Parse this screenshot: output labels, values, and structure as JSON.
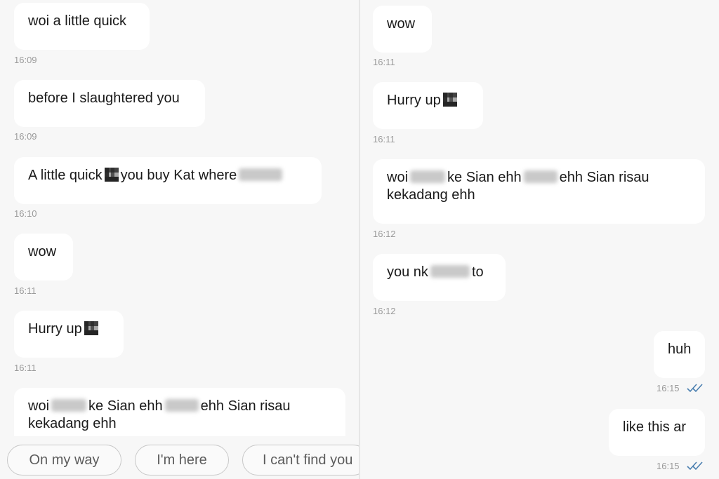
{
  "left": {
    "messages": [
      {
        "text": "woi a little quick",
        "time": "16:09"
      },
      {
        "text": "before I slaughtered you",
        "time": "16:09"
      },
      {
        "part1": "A little quick",
        "part2": "you buy Kat where",
        "time": "16:10"
      },
      {
        "text": "wow",
        "time": "16:11"
      },
      {
        "text": "Hurry up",
        "time": "16:11"
      },
      {
        "line1_a": "woi",
        "line1_b": "ke Sian ehh",
        "line1_c": "ehh Sian risau",
        "line2": "kekadang ehh"
      }
    ],
    "quick_replies": [
      "On my way",
      "I'm here",
      "I can't find you"
    ]
  },
  "right": {
    "messages": [
      {
        "text": "wow",
        "time": "16:11"
      },
      {
        "text": "Hurry up",
        "time": "16:11"
      },
      {
        "line1_a": "woi",
        "line1_b": "ke Sian ehh",
        "line1_c": "ehh Sian risau",
        "line2": "kekadang ehh",
        "time": "16:12"
      },
      {
        "part1": "you nk",
        "part2": "to",
        "time": "16:12"
      },
      {
        "text": "huh",
        "time": "16:15",
        "status": "read"
      },
      {
        "text": "like this ar",
        "time": "16:15",
        "status": "read"
      }
    ]
  },
  "colors": {
    "bubble": "#ffffff",
    "background": "#f7f7f7",
    "timestamp": "#9a9a9a",
    "read_ticks": "#4a7fb0"
  }
}
